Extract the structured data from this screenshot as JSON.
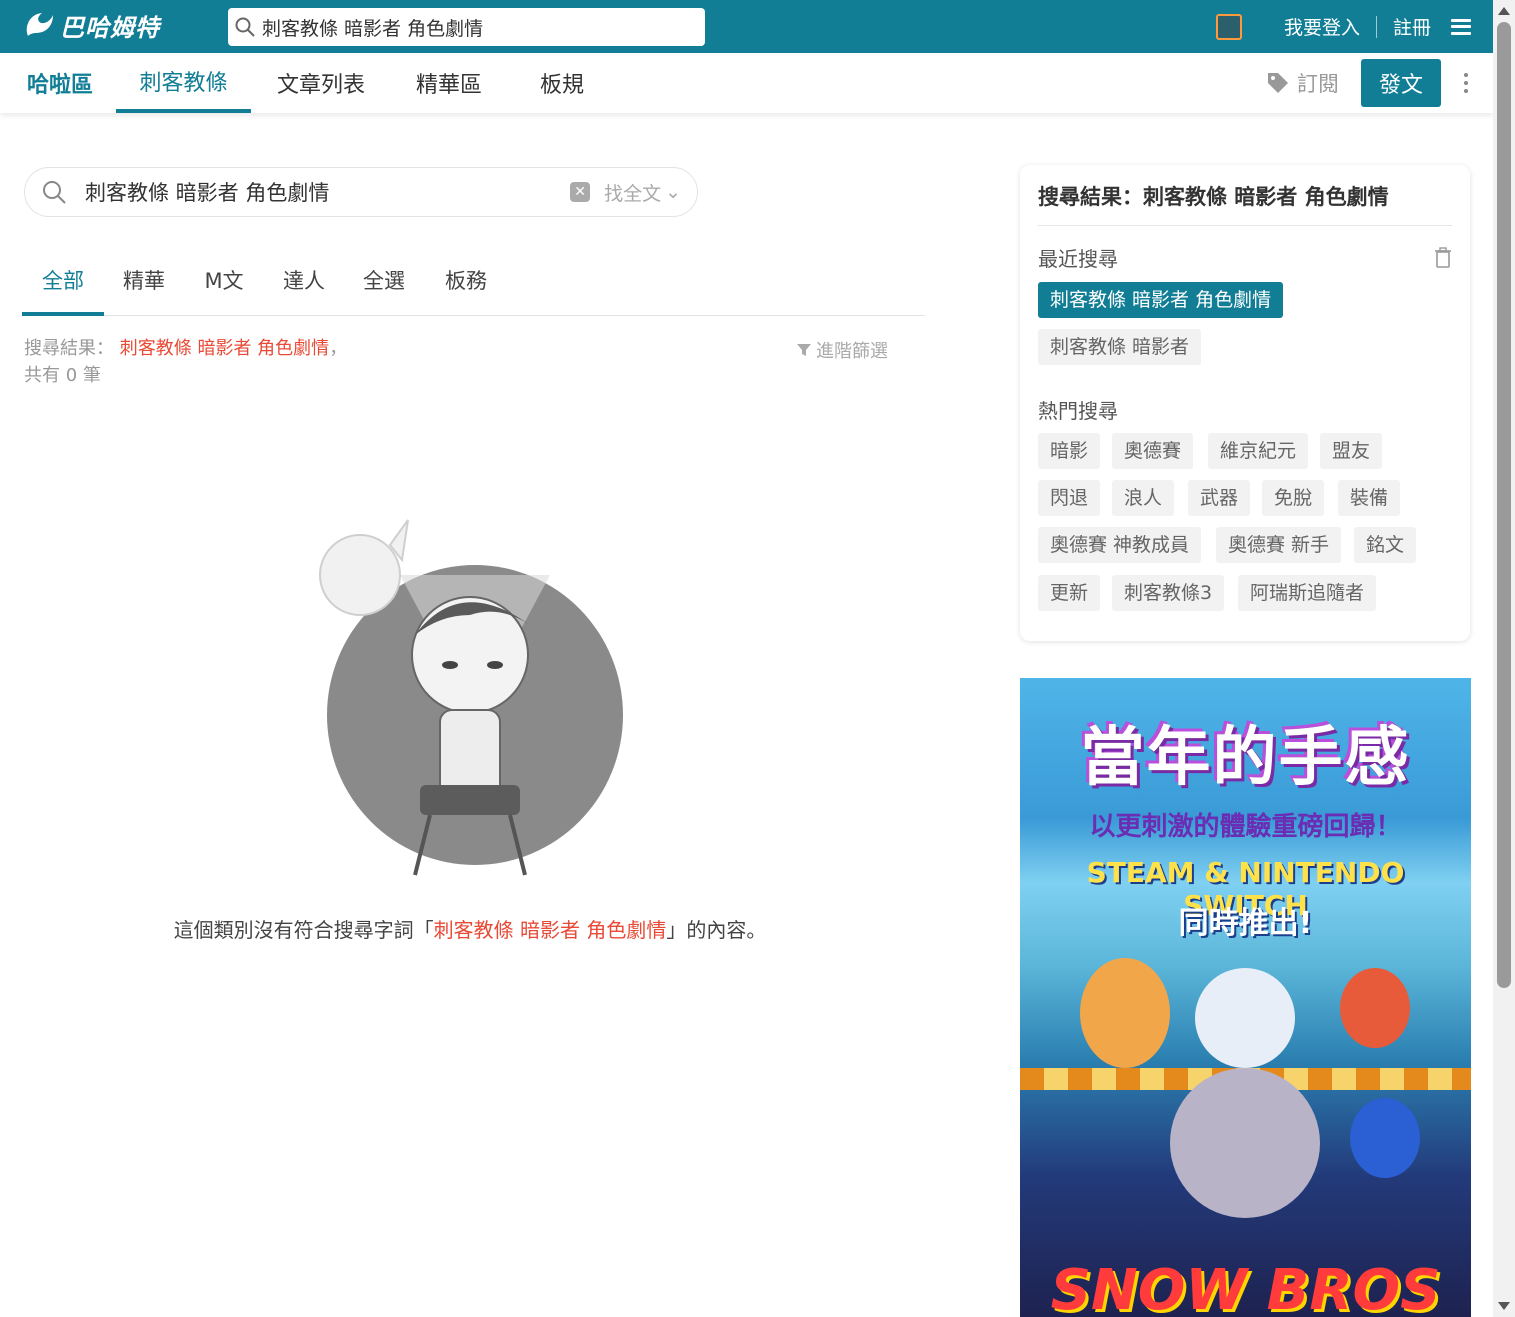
{
  "header": {
    "logo_text": "巴哈姆特",
    "search_value": "刺客教條 暗影者 角色劇情",
    "login_label": "我要登入",
    "register_label": "註冊"
  },
  "subnav": {
    "brand": "哈啦區",
    "tabs": [
      "刺客教條",
      "文章列表",
      "精華區",
      "板規"
    ],
    "subscribe_label": "訂閱",
    "post_label": "發文"
  },
  "search": {
    "query": "刺客教條 暗影者 角色劇情",
    "scope": "找全文",
    "categories": [
      "全部",
      "精華",
      "M文",
      "達人",
      "全選",
      "板務"
    ],
    "summary_prefix": "搜尋結果：",
    "summary_keyword": "刺客教條 暗影者 角色劇情",
    "summary_suffix": "，",
    "count_text": "共有 0 筆",
    "advanced_filter": "進階篩選",
    "empty_prefix": "這個類別沒有符合搜尋字詞「",
    "empty_keyword": "刺客教條 暗影者 角色劇情",
    "empty_suffix": "」的內容。"
  },
  "sidebar": {
    "title": "搜尋結果：刺客教條 暗影者 角色劇情",
    "recent_label": "最近搜尋",
    "recent": [
      "刺客教條 暗影者 角色劇情",
      "刺客教條 暗影者"
    ],
    "hot_label": "熱門搜尋",
    "hot": [
      "暗影",
      "奧德賽",
      "維京紀元",
      "盟友",
      "閃退",
      "浪人",
      "武器",
      "免脫",
      "裝備",
      "奧德賽 神教成員",
      "奧德賽 新手",
      "銘文",
      "更新",
      "刺客教條3",
      "阿瑞斯追隨者"
    ]
  },
  "ad": {
    "title": "當年的手感",
    "subtitle": "以更刺激的體驗重磅回歸！",
    "platforms": "STEAM & NINTENDO SWITCH",
    "simul": "同時推出!",
    "game_logo": "SNOW BROS"
  },
  "colors": {
    "brand": "#117e96",
    "keyword": "#e84a35"
  }
}
